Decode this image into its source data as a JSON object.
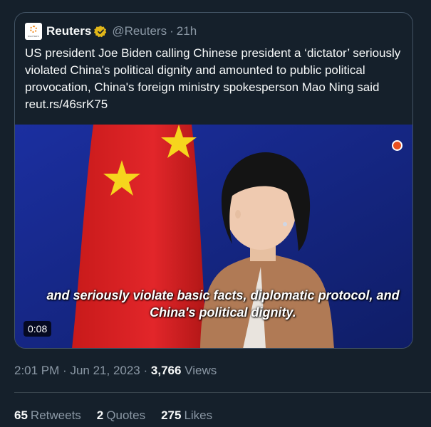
{
  "quoted_tweet": {
    "avatar_text": "REUTERS",
    "display_name": "Reuters",
    "handle": "@Reuters",
    "separator": "·",
    "time_ago": "21h",
    "text": "US president Joe Biden calling Chinese president a ‘dictator’ seriously violated China's political dignity and amounted to public political provocation, China's foreign ministry spokesperson Mao Ning said reut.rs/46srK75",
    "media": {
      "caption": "and seriously violate basic facts, diplomatic protocol, and China's political dignity.",
      "duration": "0:08"
    }
  },
  "meta": {
    "time": "2:01 PM",
    "separator": "·",
    "date": "Jun 21, 2023",
    "views_count": "3,766",
    "views_label": "Views"
  },
  "stats": [
    {
      "count": "65",
      "label": "Retweets"
    },
    {
      "count": "2",
      "label": "Quotes"
    },
    {
      "count": "275",
      "label": "Likes"
    }
  ],
  "colors": {
    "background": "#15202b",
    "secondary_text": "#8b98a5",
    "verified_badge": "#e2b719"
  }
}
